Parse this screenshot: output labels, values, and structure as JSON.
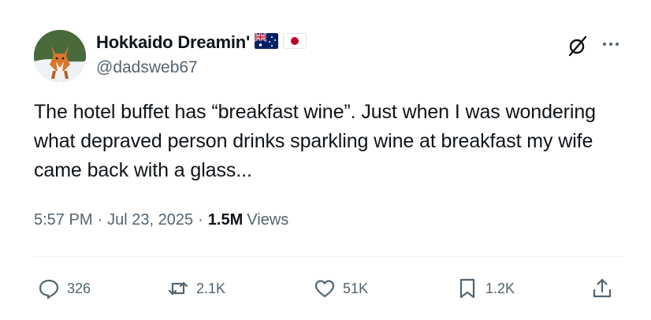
{
  "user": {
    "display_name": "Hokkaido Dreamin'",
    "handle": "@dadsweb67",
    "flags": [
      "australia-flag",
      "japan-flag"
    ]
  },
  "tweet": {
    "text": "The hotel buffet has “breakfast wine”. Just when I was wondering what depraved person drinks sparkling wine at breakfast my wife came back with a glass..."
  },
  "meta": {
    "time": "5:57 PM",
    "separator": "·",
    "date": "Jul 23, 2025",
    "views_count": "1.5M",
    "views_label": "Views"
  },
  "actions": {
    "replies": "326",
    "retweets": "2.1K",
    "likes": "51K",
    "bookmarks": "1.2K"
  },
  "icons": [
    "grok-icon",
    "more-icon",
    "reply-icon",
    "retweet-icon",
    "like-icon",
    "bookmark-icon",
    "share-icon"
  ],
  "colors": {
    "text_primary": "#0f1419",
    "text_secondary": "#536471",
    "divider": "#eff3f4"
  }
}
